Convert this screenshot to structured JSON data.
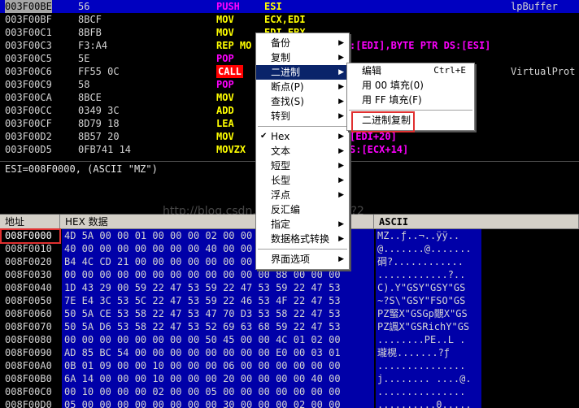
{
  "colors": {
    "mnemonic_push_pop": "#ff00ff",
    "mnemonic_yellow": "#ffff00",
    "call_bg": "#ff0000",
    "mem_operand": "#ff00ff",
    "dump_bg": "#0000a8",
    "menu_highlight": "#0a246a",
    "annotation_red": "#e03030"
  },
  "disasm": {
    "rows": [
      {
        "addr": "003F00BE",
        "hex": "56",
        "mn": "PUSH",
        "op": "ESI",
        "cmt": "lpBuffer",
        "style": "push"
      },
      {
        "addr": "003F00BF",
        "hex": "8BCF",
        "mn": "MOV",
        "op": "ECX,EDI",
        "cmt": "",
        "style": "y"
      },
      {
        "addr": "003F00C1",
        "hex": "8BFB",
        "mn": "MOV",
        "op": "EDI,EBX",
        "cmt": "",
        "style": "y"
      },
      {
        "addr": "003F00C3",
        "hex": "F3:A4",
        "mn": "REP MO",
        "op": "",
        "cmt": "",
        "style": "y",
        "tail": ":[EDI],BYTE PTR DS:[ESI]"
      },
      {
        "addr": "003F00C5",
        "hex": "5E",
        "mn": "POP",
        "op": "ES",
        "cmt": "",
        "style": "push"
      },
      {
        "addr": "003F00C6",
        "hex": "FF55 0C",
        "mn": "CALL",
        "op": "D",
        "cmt": "VirtualProt",
        "style": "call"
      },
      {
        "addr": "003F00C9",
        "hex": "58",
        "mn": "POP",
        "op": "EA",
        "cmt": "",
        "style": "push"
      },
      {
        "addr": "003F00CA",
        "hex": "8BCE",
        "mn": "MOV",
        "op": "EC",
        "cmt": "",
        "style": "y"
      },
      {
        "addr": "003F00CC",
        "hex": "0349 3C",
        "mn": "ADD",
        "op": "EC",
        "cmt": "",
        "style": "y"
      },
      {
        "addr": "003F00CF",
        "hex": "8D79 18",
        "mn": "LEA",
        "op": "ED",
        "cmt": "",
        "style": "y"
      },
      {
        "addr": "003F00D2",
        "hex": "8B57 20",
        "mn": "MOV",
        "op": "ED",
        "cmt": "",
        "style": "y",
        "tail": "[EDI+20]"
      },
      {
        "addr": "003F00D5",
        "hex": "0FB741 14",
        "mn": "MOVZX",
        "op": "",
        "cmt": "",
        "style": "y",
        "tail": "S:[ECX+14]"
      }
    ]
  },
  "info": {
    "text": "ESI=008F0000, (ASCII \"MZ\")"
  },
  "dump": {
    "header_addr": "地址",
    "header_hex": "HEX 数据",
    "header_ascii": "ASCII",
    "rows": [
      {
        "addr": "008F0000",
        "bytes": "4D 5A 00 00 01 00 00 00 02 00 00 00 FF FF 00 00",
        "ascii": "MZ..ƒ..¬..ÿÿ.."
      },
      {
        "addr": "008F0010",
        "bytes": "40 00 00 00 00 00 00 00 40 00 00 00 00 00 00 00",
        "ascii": "@.......@......."
      },
      {
        "addr": "008F0020",
        "bytes": "B4 4C CD 21 00 00 00 00 00 00 00 00 00 00 00 00",
        "ascii": "碙?............"
      },
      {
        "addr": "008F0030",
        "bytes": "00 00 00 00 00 00 00 00 00 00 00 00 88 00 00 00",
        "ascii": "............?.."
      },
      {
        "addr": "008F0040",
        "bytes": "1D 43 29 00 59 22 47 53 59 22 47 53 59 22 47 53",
        "ascii": "C).Y\"GSY\"GSY\"GS"
      },
      {
        "addr": "008F0050",
        "bytes": "7E E4 3C 53 5C 22 47 53 59 22 46 53 4F 22 47 53",
        "ascii": "~?S\\\"GSY\"FSO\"GS"
      },
      {
        "addr": "008F0060",
        "bytes": "50 5A CE 53 58 22 47 53 47 70 D3 53 58 22 47 53",
        "ascii": "PZ蜸X\"GSGp覵X\"GS"
      },
      {
        "addr": "008F0070",
        "bytes": "50 5A D6 53 58 22 47 53 52 69 63 68 59 22 47 53",
        "ascii": "PZ諷X\"GSRichY\"GS"
      },
      {
        "addr": "008F0080",
        "bytes": "00 00 00 00 00 00 00 00 50 45 00 00 4C 01 02 00",
        "ascii": "........PE..L ."
      },
      {
        "addr": "008F0090",
        "bytes": "AD 85 BC 54 00 00 00 00 00 00 00 00 E0 00 03 01",
        "ascii": "瓏榥.......?ƒ"
      },
      {
        "addr": "008F00A0",
        "bytes": "0B 01 09 00 00 10 00 00 00 06 00 00 00 00 00 00",
        "ascii": "..............."
      },
      {
        "addr": "008F00B0",
        "bytes": "6A 14 00 00 00 10 00 00 00 20 00 00 00 00 40 00",
        "ascii": "j........ ....@."
      },
      {
        "addr": "008F00C0",
        "bytes": "00 10 00 00 00 02 00 00 05 00 00 00 00 00 00 00",
        "ascii": "..............."
      },
      {
        "addr": "008F00D0",
        "bytes": "05 00 00 00 00 00 00 00 00 30 00 00 00 02 00 00",
        "ascii": "..........0....."
      }
    ]
  },
  "menu1": {
    "items": [
      {
        "label": "备份",
        "arrow": true
      },
      {
        "label": "复制",
        "arrow": true
      },
      {
        "label": "二进制",
        "arrow": true,
        "active": true
      },
      {
        "label": "断点(P)",
        "arrow": true
      },
      {
        "label": "查找(S)",
        "arrow": true
      },
      {
        "label": "转到",
        "arrow": true
      },
      {
        "sep": true
      },
      {
        "label": "Hex",
        "arrow": true,
        "check": true
      },
      {
        "label": "文本",
        "arrow": true
      },
      {
        "label": "短型",
        "arrow": true
      },
      {
        "label": "长型",
        "arrow": true
      },
      {
        "label": "浮点",
        "arrow": true
      },
      {
        "label": "反汇编",
        "arrow": false
      },
      {
        "label": "指定",
        "arrow": true
      },
      {
        "label": "数据格式转换",
        "arrow": true
      },
      {
        "sep": true
      },
      {
        "label": "界面选项",
        "arrow": true
      }
    ]
  },
  "menu2": {
    "edit_label": "编辑",
    "edit_shortcut": "Ctrl+E",
    "fill00_label": "用 00 填充(0)",
    "fillff_label": "用 FF 填充(F)",
    "bincopy_label": "二进制复制"
  },
  "watermark": "http://blog.csdn.net/u010842831?2"
}
